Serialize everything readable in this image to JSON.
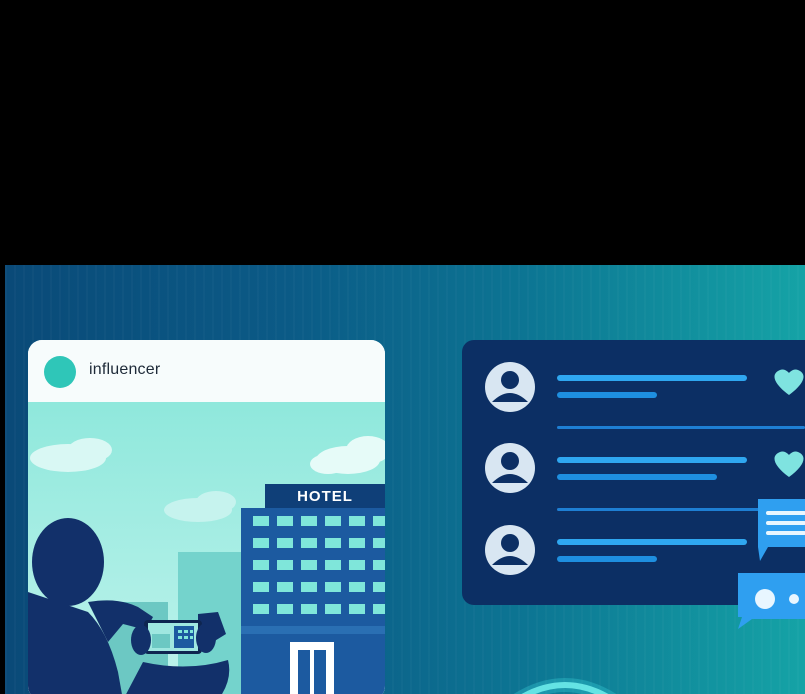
{
  "post": {
    "username": "influencer",
    "building_sign": "HOTEL"
  },
  "comments": [
    {
      "id": 1,
      "liked": true
    },
    {
      "id": 2,
      "liked": true
    },
    {
      "id": 3,
      "liked": false
    }
  ],
  "icons": [
    "avatar-icon",
    "heart-icon",
    "chat-bubble-icon",
    "phone-camera-icon"
  ],
  "colors": {
    "accent_teal": "#2fc6b8",
    "panel_navy": "#0c2f64",
    "line_blue": "#1e9ae8",
    "heart": "#7fe3e0"
  }
}
